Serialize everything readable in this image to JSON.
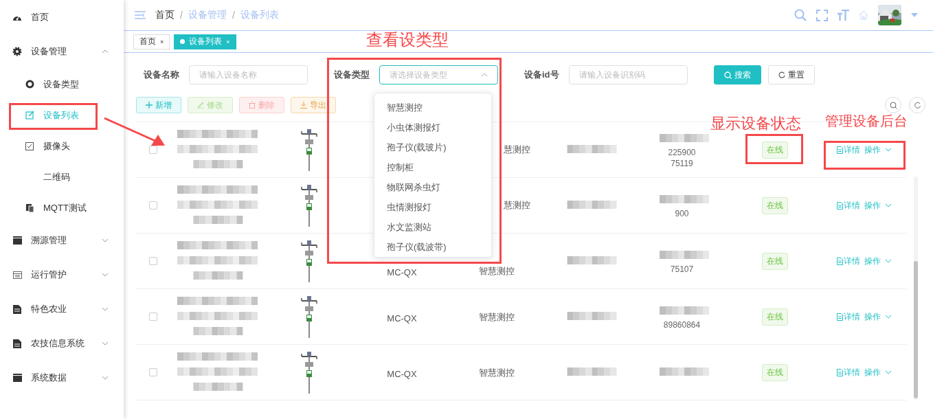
{
  "sidebar": {
    "items": [
      {
        "label": "首页",
        "kind": "link",
        "selected": false
      },
      {
        "label": "设备管理",
        "kind": "group",
        "expanded": true,
        "children": [
          {
            "label": "设备类型",
            "selected": false
          },
          {
            "label": "设备列表",
            "selected": true
          },
          {
            "label": "摄像头",
            "selected": false
          },
          {
            "label": "二维码",
            "selected": false
          },
          {
            "label": "MQTT测试",
            "selected": false
          }
        ]
      },
      {
        "label": "溯源管理",
        "kind": "group",
        "expanded": false
      },
      {
        "label": "运行管护",
        "kind": "group",
        "expanded": false
      },
      {
        "label": "特色农业",
        "kind": "group",
        "expanded": false
      },
      {
        "label": "农技信息系统",
        "kind": "group",
        "expanded": false
      },
      {
        "label": "系统数据",
        "kind": "group",
        "expanded": false
      }
    ]
  },
  "header": {
    "breadcrumb": [
      "首页",
      "设备管理",
      "设备列表"
    ],
    "breadcrumb_separators": [
      "/",
      "/"
    ]
  },
  "tags": [
    {
      "label": "首页",
      "selected": false,
      "close": "×"
    },
    {
      "label": "设备列表",
      "selected": true,
      "close": "×"
    }
  ],
  "filters": [
    {
      "label": "设备名称",
      "kind": "input",
      "placeholder": "请输入设备名称"
    },
    {
      "label": "设备类型",
      "kind": "select",
      "placeholder": "请选择设备类型",
      "expanded": true,
      "options": [
        "智慧测控",
        "小虫体测报灯",
        "孢子仪(载玻片)",
        "控制柜",
        "物联网杀虫灯",
        "虫情测报灯",
        "水文监测站",
        "孢子仪(载波带)"
      ]
    },
    {
      "label": "设备id号",
      "kind": "input",
      "placeholder": "请输入设备识别码"
    }
  ],
  "filter_buttons": [
    {
      "label": "搜索",
      "kind": "primary"
    },
    {
      "label": "重置",
      "kind": "plain"
    }
  ],
  "toolbar": [
    {
      "label": "新增",
      "kind": "add"
    },
    {
      "label": "修改",
      "kind": "edit"
    },
    {
      "label": "删除",
      "kind": "delete"
    },
    {
      "label": "导出",
      "kind": "export"
    }
  ],
  "rows": [
    {
      "checked": false,
      "type": "慧测控",
      "id_fragments": [
        "225900",
        "75119"
      ],
      "status": "在线",
      "online": true,
      "actions": [
        "详情",
        "操作"
      ]
    },
    {
      "checked": false,
      "type": "慧测控",
      "id_fragments": [
        "900"
      ],
      "status": "在线",
      "online": true,
      "actions": [
        "详情",
        "操作"
      ]
    },
    {
      "checked": false,
      "model": "MC-QX",
      "type": "智慧测控",
      "id_fragments": [
        "75107"
      ],
      "status": "在线",
      "online": true,
      "actions": [
        "详情",
        "操作"
      ]
    },
    {
      "checked": false,
      "model": "MC-QX",
      "type": "智慧测控",
      "id_fragments": [
        "89860864"
      ],
      "status": "在线",
      "online": true,
      "actions": [
        "详情",
        "操作"
      ]
    },
    {
      "checked": false,
      "model": "MC-QX",
      "type": "智慧测控",
      "status": "在线",
      "online": true,
      "actions": [
        "详情",
        "操作"
      ]
    }
  ],
  "annotations": [
    {
      "text": "查看设类型"
    },
    {
      "text": "显示设备状态"
    },
    {
      "text": "管理设备后台"
    }
  ]
}
